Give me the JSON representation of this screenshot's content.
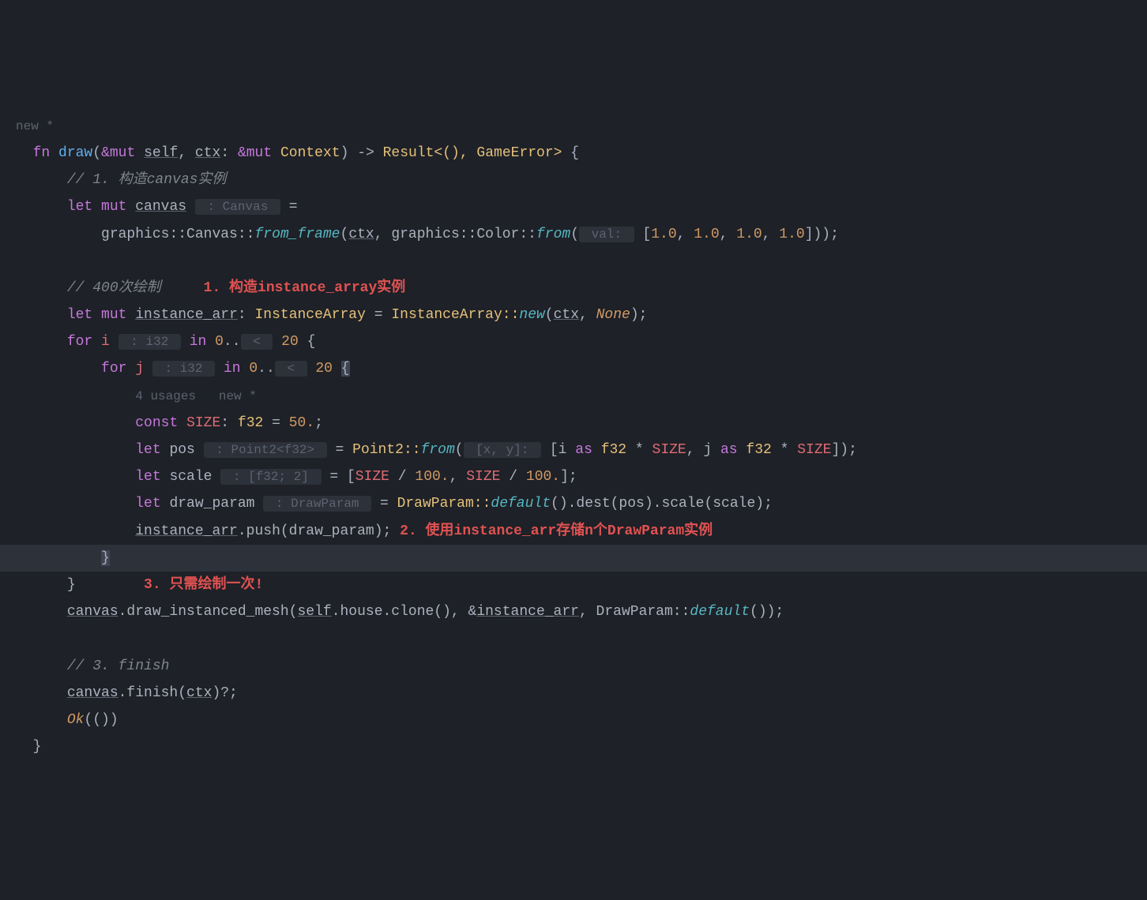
{
  "header_hint": "new *",
  "fn_line": {
    "kw_fn": "fn",
    "name": "draw",
    "self_ref": "&mut",
    "self_param": "self",
    "ctx_param": "ctx",
    "ctx_ref": "&mut",
    "ctx_type": "Context",
    "ret": "Result<(), GameError>"
  },
  "comment1": "// 1. 构造canvas实例",
  "let_canvas": {
    "kw_let": "let",
    "kw_mut": "mut",
    "var": "canvas",
    "hint": " : Canvas ",
    "eq": "="
  },
  "canvas_init": {
    "path1": "graphics::Canvas::",
    "fn": "from_frame",
    "arg1": "ctx",
    "path2": "graphics::Color::",
    "fn2": "from",
    "hint_val": " val: ",
    "nums": [
      "1.0",
      "1.0",
      "1.0",
      "1.0"
    ]
  },
  "comment2": "// 400次绘制",
  "annotation1": "1. 构造instance_array实例",
  "let_inst": {
    "kw_let": "let",
    "kw_mut": "mut",
    "var": "instance_arr",
    "type": "InstanceArray",
    "eq": "=",
    "ctor": "InstanceArray::",
    "fn": "new",
    "arg1": "ctx",
    "arg2": "None"
  },
  "for_outer": {
    "kw_for": "for",
    "var": "i",
    "hint": " : i32 ",
    "kw_in": "in",
    "start": "0",
    "end_hint": " < ",
    "end": "20"
  },
  "for_inner": {
    "kw_for": "for",
    "var": "j",
    "hint": " : i32 ",
    "kw_in": "in",
    "start": "0",
    "end_hint": " < ",
    "end": "20"
  },
  "usages_hint": "4 usages   new *",
  "const_size": {
    "kw": "const",
    "name": "SIZE",
    "type": "f32",
    "val": "50."
  },
  "let_pos": {
    "kw": "let",
    "var": "pos",
    "hint": " : Point2<f32> ",
    "eq": "=",
    "ctor": "Point2::",
    "fn": "from",
    "hint_xy": " [x, y]: ",
    "i_var": "i",
    "as_kw": "as",
    "f32": "f32",
    "star": "*",
    "size": "SIZE",
    "j_var": "j"
  },
  "let_scale": {
    "kw": "let",
    "var": "scale",
    "hint": " : [f32; 2] ",
    "eq": "=",
    "size": "SIZE",
    "div": "/",
    "hundred": "100."
  },
  "let_draw_param": {
    "kw": "let",
    "var": "draw_param",
    "hint": " : DrawParam ",
    "eq": "=",
    "ctor": "DrawParam::",
    "fn": "default",
    "dest": ".dest(pos).scale(scale);"
  },
  "push_line": {
    "var": "instance_arr",
    "call": ".push(draw_param);"
  },
  "annotation2": "2. 使用instance_arr存储n个DrawParam实例",
  "annotation3": "3. 只需绘制一次!",
  "draw_call": {
    "var": "canvas",
    "fn": ".draw_instanced_mesh(",
    "self": "self",
    "house": ".house.clone(), &",
    "inst": "instance_arr",
    "rest": ", DrawParam::",
    "default": "default",
    "end": "());"
  },
  "comment3": "// 3. finish",
  "finish_line": {
    "var": "canvas",
    "call": ".finish(",
    "ctx": "ctx",
    "end": ")?;"
  },
  "ok_line": {
    "ok": "Ok",
    "body": "(())"
  }
}
